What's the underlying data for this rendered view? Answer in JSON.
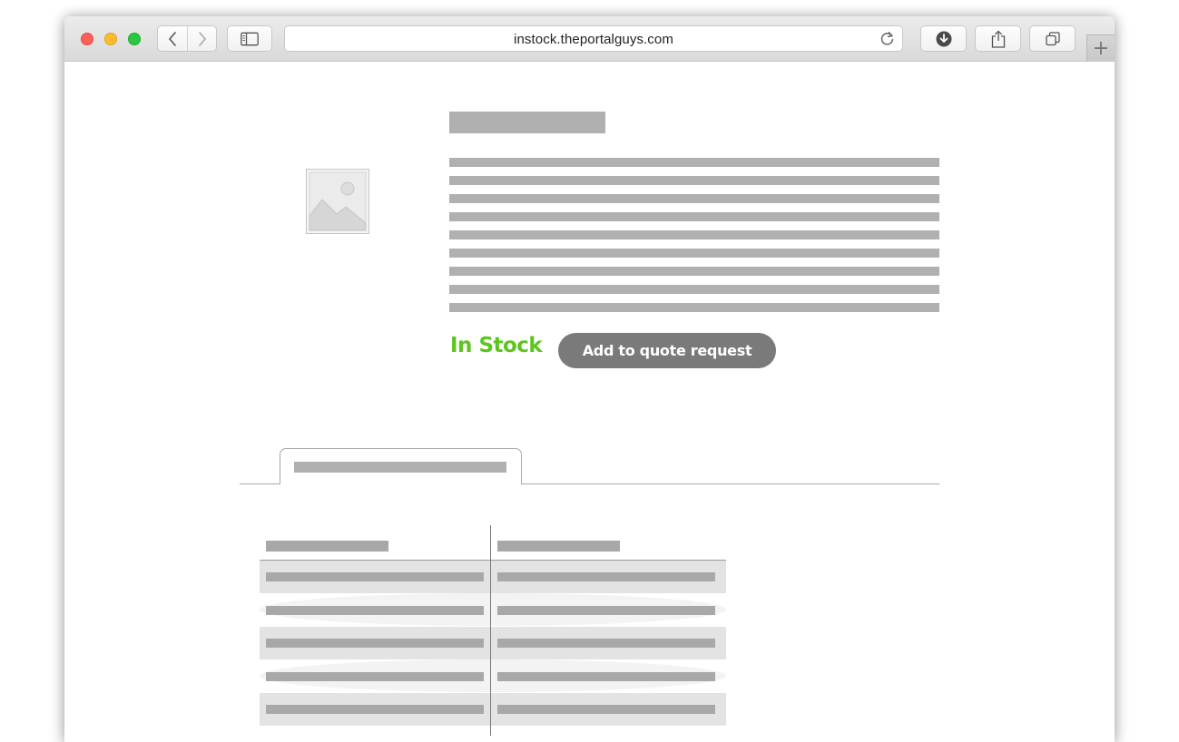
{
  "browser": {
    "url": "instock.theportalguys.com",
    "new_tab_symbol": "+"
  },
  "product": {
    "stock_status": "In Stock",
    "quote_button_label": "Add to quote request",
    "description_line_count": 9
  },
  "specs_table": {
    "row_count": 5
  },
  "colors": {
    "stock_green": "#5cc51e",
    "button_gray": "#7a7a7a",
    "placeholder_gray": "#b0b0b0"
  }
}
